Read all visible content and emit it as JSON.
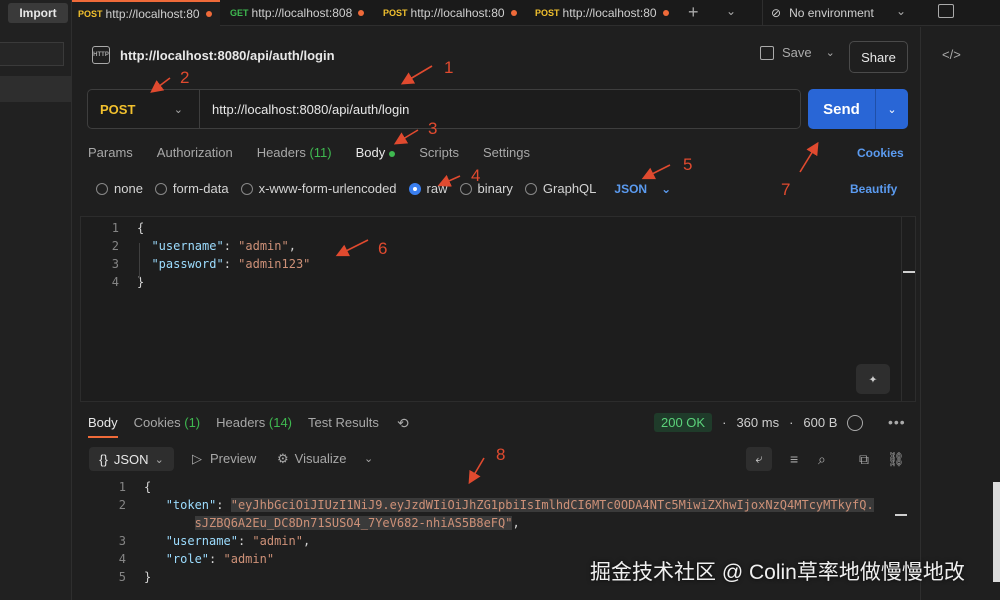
{
  "left_sidebar": {
    "import_label": "Import"
  },
  "tabs": [
    {
      "method": "POST",
      "label": "http://localhost:80"
    },
    {
      "method": "GET",
      "label": "http://localhost:808"
    },
    {
      "method": "POST",
      "label": "http://localhost:80"
    },
    {
      "method": "POST",
      "label": "http://localhost:80"
    }
  ],
  "environment": {
    "label": "No environment"
  },
  "request": {
    "title": "http://localhost:8080/api/auth/login",
    "http_badge": "HTTP",
    "save_label": "Save",
    "share_label": "Share",
    "method": "POST",
    "url": "http://localhost:8080/api/auth/login",
    "send_label": "Send",
    "tabs": {
      "params": "Params",
      "authorization": "Authorization",
      "headers": "Headers",
      "headers_count": "(11)",
      "body": "Body",
      "scripts": "Scripts",
      "settings": "Settings"
    },
    "cookies_label": "Cookies",
    "body_types": {
      "none": "none",
      "form_data": "form-data",
      "urlencoded": "x-www-form-urlencoded",
      "raw": "raw",
      "binary": "binary",
      "graphql": "GraphQL"
    },
    "raw_format": "JSON",
    "beautify_label": "Beautify",
    "body_lines": {
      "ln1": "1",
      "ln2": "2",
      "ln3": "3",
      "ln4": "4",
      "open": "{",
      "username_key": "\"username\"",
      "username_val": "\"admin\"",
      "password_key": "\"password\"",
      "password_val": "\"admin123\"",
      "close": "}"
    }
  },
  "response": {
    "tabs": {
      "body": "Body",
      "cookies": "Cookies",
      "cookies_count": "(1)",
      "headers": "Headers",
      "headers_count": "(14)",
      "test_results": "Test Results"
    },
    "status": "200 OK",
    "time": "360 ms",
    "size": "600 B",
    "format": "JSON",
    "preview_label": "Preview",
    "visualize_label": "Visualize",
    "lines": {
      "ln1": "1",
      "ln2": "2",
      "ln3": "3",
      "ln4": "4",
      "ln5": "5",
      "open": "{",
      "token_key": "\"token\"",
      "token_val_1": "\"eyJhbGciOiJIUzI1NiJ9.eyJzdWIiOiJhZG1pbiIsImlhdCI6MTc0ODA4NTc5MiwiZXhwIjoxNzQ4MTcyMTkyfQ.",
      "token_val_2": "sJZBQ6A2Eu_DC8Dn71SUSO4_7YeV682-nhiAS5B8eFQ\"",
      "username_key": "\"username\"",
      "username_val": "\"admin\"",
      "role_key": "\"role\"",
      "role_val": "\"admin\"",
      "close": "}"
    }
  },
  "watermark": "掘金技术社区 @ Colin草率地做慢慢地改",
  "annotations": [
    "1",
    "2",
    "3",
    "4",
    "5",
    "6",
    "7",
    "8"
  ],
  "colors": {
    "accent_orange": "#ef6a39",
    "send_blue": "#2966d6",
    "method_yellow": "#f2c12e",
    "link_blue": "#5b9bf0",
    "status_green": "#5bd27a",
    "annotation_red": "#e04a2f"
  }
}
